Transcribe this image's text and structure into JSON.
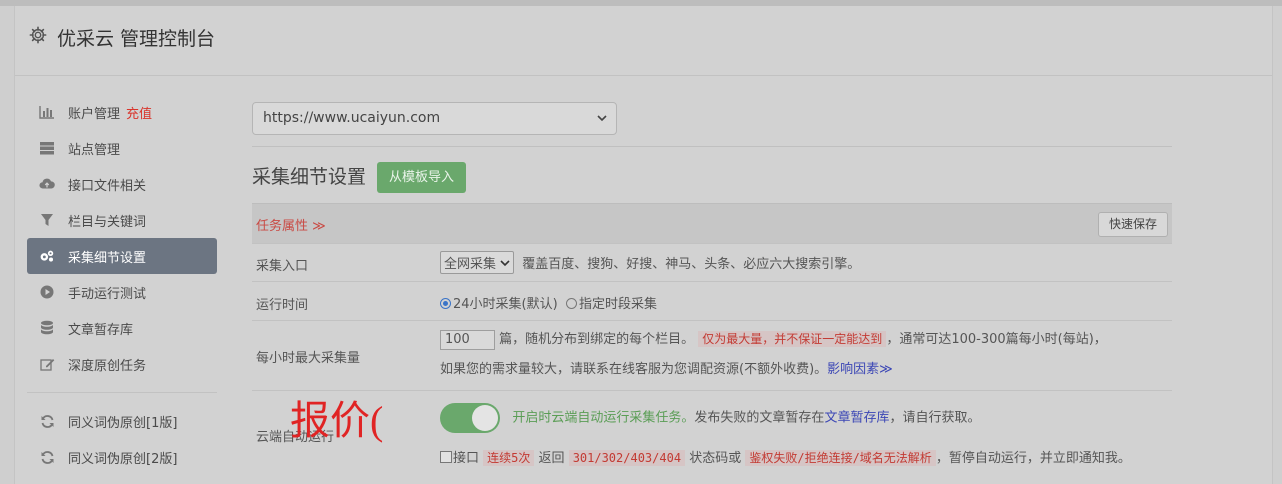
{
  "header": {
    "title": "优采云 管理控制台"
  },
  "sidebar": {
    "items": [
      {
        "label": "账户管理",
        "accent": "充值",
        "icon": "bar-chart-icon"
      },
      {
        "label": "站点管理",
        "icon": "server-icon"
      },
      {
        "label": "接口文件相关",
        "icon": "cloud-upload-icon"
      },
      {
        "label": "栏目与关键词",
        "icon": "filter-icon"
      },
      {
        "label": "采集细节设置",
        "icon": "gears-icon",
        "active": true
      },
      {
        "label": "手动运行测试",
        "icon": "play-circle-icon"
      },
      {
        "label": "文章暂存库",
        "icon": "database-icon"
      },
      {
        "label": "深度原创任务",
        "icon": "edit-icon"
      }
    ],
    "items2": [
      {
        "label": "同义词伪原创[1版]",
        "icon": "refresh-icon"
      },
      {
        "label": "同义词伪原创[2版]",
        "icon": "refresh-icon"
      }
    ]
  },
  "main": {
    "site_select": "https://www.ucaiyun.com",
    "section_title": "采集细节设置",
    "import_button": "从模板导入",
    "task_attr": "任务属性 ≫",
    "quick_save": "快速保存",
    "rows": {
      "entry": {
        "label": "采集入口",
        "select_value": "全网采集",
        "desc": "覆盖百度、搜狗、好搜、神马、头条、必应六大搜索引擎。"
      },
      "runtime": {
        "label": "运行时间",
        "opt1": "24小时采集(默认)",
        "opt2": "指定时段采集"
      },
      "max_per_hour": {
        "label": "每小时最大采集量",
        "value": "100",
        "text1": "篇，随机分布到绑定的每个栏目。",
        "warn": "仅为最大量，并不保证一定能达到",
        "text2": "，通常可达100-300篇每小时(每站)，",
        "text3": "如果您的需求量较大，请联系在线客服为您调配资源(不额外收费)。",
        "link": "影响因素≫"
      },
      "cloud_auto": {
        "label": "云端自动运行",
        "green": "开启时云端自动运行采集任务。",
        "text1": "发布失败的文章暂存在",
        "link": "文章暂存库",
        "text2": "，请自行获取。",
        "cb_label": "接口",
        "warn1": "连续5次",
        "text3": "返回",
        "warn2": "301/302/403/404",
        "text4": "状态码或",
        "warn3": "鉴权失败/拒绝连接/域名无法解析",
        "text5": "，暂停自动运行，并立即通知我。"
      }
    }
  },
  "overlay": "报价("
}
